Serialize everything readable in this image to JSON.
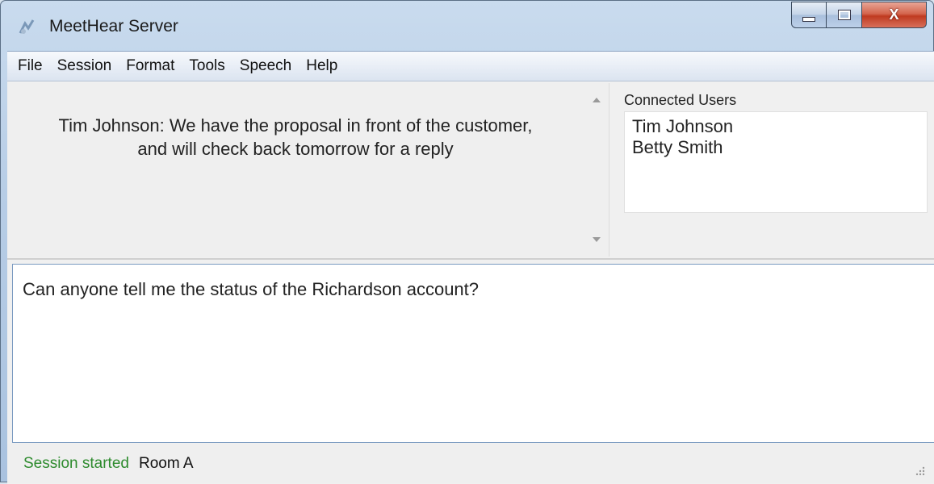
{
  "window": {
    "title": "MeetHear Server",
    "close_glyph": "X"
  },
  "menu": [
    "File",
    "Session",
    "Format",
    "Tools",
    "Speech",
    "Help"
  ],
  "transcript": {
    "line1": "Tim Johnson:  We have the proposal in front of the customer,",
    "line2": "and will check back tomorrow for a reply"
  },
  "users_panel": {
    "label": "Connected Users",
    "users": [
      "Tim Johnson",
      "Betty Smith"
    ]
  },
  "input": {
    "text": "Can anyone tell me the status of the Richardson account?"
  },
  "status": {
    "state": "Session started",
    "room": "Room A"
  },
  "colors": {
    "status_started": "#2e8b2e",
    "close_button": "#c94a30"
  }
}
